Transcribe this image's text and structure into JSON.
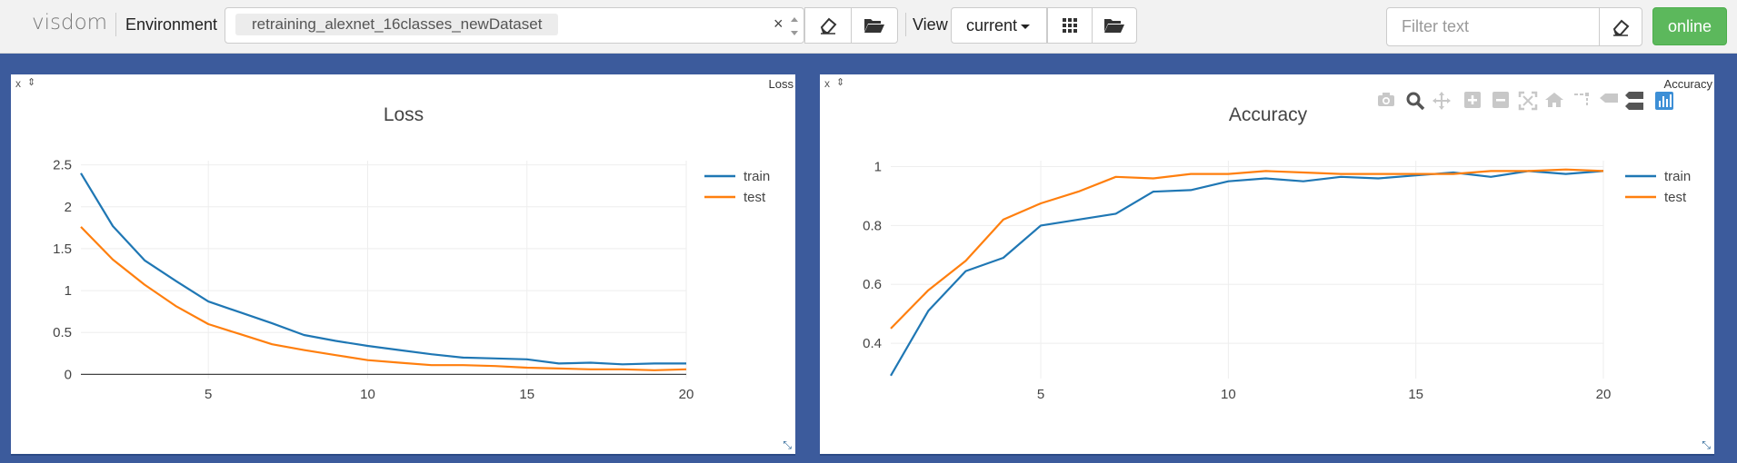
{
  "app": {
    "brand": "visdom"
  },
  "environment": {
    "label": "Environment",
    "selected": "retraining_alexnet_16classes_newDataset",
    "clear_glyph": "×"
  },
  "view": {
    "label": "View",
    "selected": "current"
  },
  "filter": {
    "placeholder": "Filter text"
  },
  "status": {
    "label": "online",
    "color": "#5cb85c"
  },
  "icons": [
    "eraser-icon",
    "folder-open-icon",
    "grid-icon",
    "folder-open-icon",
    "eraser-icon"
  ],
  "panes": [
    {
      "tag": "Loss",
      "close": "x",
      "pin": "⇕",
      "resize": "⤡"
    },
    {
      "tag": "Accuracy",
      "close": "x",
      "pin": "⇕",
      "resize": "⤡"
    }
  ],
  "chart_data": [
    {
      "type": "line",
      "title": "Loss",
      "x": [
        1,
        2,
        3,
        4,
        5,
        6,
        7,
        8,
        9,
        10,
        11,
        12,
        13,
        14,
        15,
        16,
        17,
        18,
        19,
        20
      ],
      "series": [
        {
          "name": "train",
          "color": "#1f77b4",
          "values": [
            2.4,
            1.77,
            1.36,
            1.11,
            0.87,
            0.74,
            0.61,
            0.47,
            0.4,
            0.34,
            0.29,
            0.24,
            0.2,
            0.19,
            0.18,
            0.13,
            0.14,
            0.12,
            0.13,
            0.13
          ]
        },
        {
          "name": "test",
          "color": "#ff7f0e",
          "values": [
            1.76,
            1.37,
            1.07,
            0.81,
            0.6,
            0.48,
            0.36,
            0.29,
            0.23,
            0.17,
            0.14,
            0.11,
            0.11,
            0.1,
            0.08,
            0.07,
            0.06,
            0.06,
            0.05,
            0.06
          ]
        }
      ],
      "xlim": [
        1,
        20
      ],
      "ylim": [
        -0.05,
        2.55
      ],
      "xticks": [
        5,
        10,
        15,
        20
      ],
      "yticks": [
        0,
        0.5,
        1,
        1.5,
        2,
        2.5
      ],
      "ytick_labels": [
        "0",
        "0.5",
        "1",
        "1.5",
        "2",
        "2.5"
      ],
      "grid": true,
      "legend": "top-right"
    },
    {
      "type": "line",
      "title": "Accuracy",
      "x": [
        1,
        2,
        3,
        4,
        5,
        6,
        7,
        8,
        9,
        10,
        11,
        12,
        13,
        14,
        15,
        16,
        17,
        18,
        19,
        20
      ],
      "series": [
        {
          "name": "train",
          "color": "#1f77b4",
          "values": [
            0.29,
            0.51,
            0.645,
            0.69,
            0.8,
            0.82,
            0.84,
            0.915,
            0.92,
            0.95,
            0.96,
            0.95,
            0.965,
            0.96,
            0.97,
            0.98,
            0.965,
            0.985,
            0.975,
            0.985
          ]
        },
        {
          "name": "test",
          "color": "#ff7f0e",
          "values": [
            0.45,
            0.58,
            0.68,
            0.82,
            0.875,
            0.915,
            0.965,
            0.96,
            0.975,
            0.975,
            0.985,
            0.98,
            0.975,
            0.975,
            0.975,
            0.975,
            0.985,
            0.985,
            0.99,
            0.985
          ]
        }
      ],
      "xlim": [
        1,
        20
      ],
      "ylim": [
        0.28,
        1.02
      ],
      "xticks": [
        5,
        10,
        15,
        20
      ],
      "yticks": [
        0.4,
        0.6,
        0.8,
        1
      ],
      "ytick_labels": [
        "0.4",
        "0.6",
        "0.8",
        "1"
      ],
      "grid": true,
      "legend": "top-right"
    }
  ]
}
